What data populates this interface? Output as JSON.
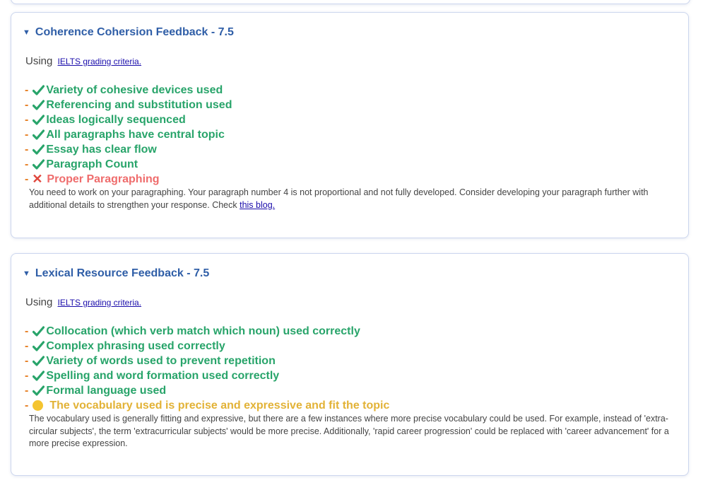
{
  "colors": {
    "heading": "#2f5ea7",
    "pass": "#28a46a",
    "fail": "#ef6c6c",
    "warn": "#e2b236",
    "dash": "#e67e22"
  },
  "sections": [
    {
      "title": "Coherence Cohersion Feedback - 7.5",
      "using_prefix": "Using",
      "criteria_link": "IELTS grading criteria.",
      "items": [
        {
          "status": "pass",
          "icon": "check-icon",
          "text": "Variety of cohesive devices used"
        },
        {
          "status": "pass",
          "icon": "check-icon",
          "text": "Referencing and substitution used"
        },
        {
          "status": "pass",
          "icon": "check-icon",
          "text": "Ideas logically sequenced"
        },
        {
          "status": "pass",
          "icon": "check-icon",
          "text": "All paragraphs have central topic"
        },
        {
          "status": "pass",
          "icon": "check-icon",
          "text": "Essay has clear flow"
        },
        {
          "status": "pass",
          "icon": "check-icon",
          "text": "Paragraph Count"
        },
        {
          "status": "fail",
          "icon": "cross-icon",
          "text": "Proper Paragraphing"
        }
      ],
      "detail": "You need to work on your paragraphing. Your paragraph number 4 is not proportional and not fully developed. Consider developing your paragraph further with additional details to strengthen your response. Check ",
      "detail_link": "this blog."
    },
    {
      "title": "Lexical Resource Feedback - 7.5",
      "using_prefix": "Using",
      "criteria_link": "IELTS grading criteria.",
      "items": [
        {
          "status": "pass",
          "icon": "check-icon",
          "text": "Collocation (which verb match which noun) used correctly"
        },
        {
          "status": "pass",
          "icon": "check-icon",
          "text": "Complex phrasing used correctly"
        },
        {
          "status": "pass",
          "icon": "check-icon",
          "text": "Variety of words used to prevent repetition"
        },
        {
          "status": "pass",
          "icon": "check-icon",
          "text": "Spelling and word formation used correctly"
        },
        {
          "status": "pass",
          "icon": "check-icon",
          "text": "Formal language used"
        },
        {
          "status": "warn",
          "icon": "yellow-circle-icon",
          "text": "The vocabulary used is precise and expressive and fit the topic"
        }
      ],
      "detail": "The vocabulary used is generally fitting and expressive, but there are a few instances where more precise vocabulary could be used. For example, instead of 'extra-circular subjects', the term 'extracurricular subjects' would be more precise. Additionally, 'rapid career progression' could be replaced with 'career advancement' for a more precise expression."
    }
  ]
}
